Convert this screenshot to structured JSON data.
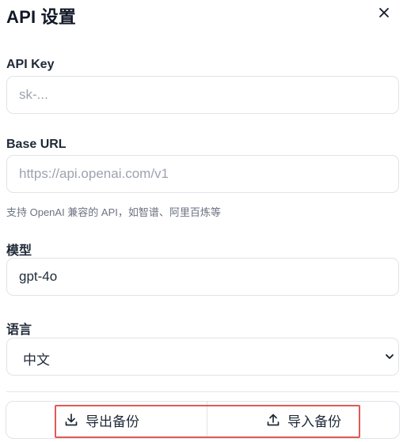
{
  "dialog": {
    "title": "API 设置"
  },
  "fields": {
    "api_key": {
      "label": "API Key",
      "placeholder": "sk-..."
    },
    "base_url": {
      "label": "Base URL",
      "placeholder": "https://api.openai.com/v1",
      "hint": "支持 OpenAI 兼容的 API，如智谱、阿里百炼等"
    },
    "model": {
      "label": "模型",
      "value": "gpt-4o"
    },
    "language": {
      "label": "语言",
      "selected": "中文"
    }
  },
  "actions": {
    "export_label": "导出备份",
    "import_label": "导入备份"
  },
  "icons": {
    "close": "close-icon",
    "dropdown": "chevron-down-icon",
    "export": "download-icon",
    "import": "upload-icon"
  },
  "colors": {
    "highlight_border": "#e05a56",
    "border": "#dfe3e8",
    "placeholder": "#9ca3af",
    "hint": "#6b7280"
  }
}
